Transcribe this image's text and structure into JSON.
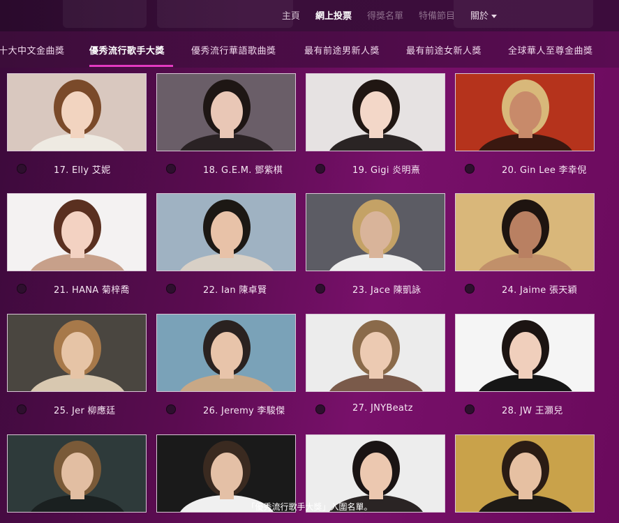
{
  "nav": {
    "home": "主頁",
    "vote": "網上投票",
    "winners": "得獎名單",
    "special": "特備節目",
    "about": "關於"
  },
  "tabs": [
    "十大中文金曲獎",
    "優秀流行歌手大獎",
    "優秀流行華語歌曲獎",
    "最有前途男新人獎",
    "最有前途女新人獎",
    "全球華人至尊金曲獎"
  ],
  "active_tab": "優秀流行歌手大獎",
  "candidates": [
    {
      "label": "17. Elly 艾妮",
      "bg": "#d9c8bf",
      "hair": "#7a4a2a",
      "skin": "#f2d4c0",
      "cloth": "#eeeae2"
    },
    {
      "label": "18. G.E.M. 鄧紫棋",
      "bg": "#6a5e68",
      "hair": "#1e1614",
      "skin": "#e9c7b6",
      "cloth": "#2a2224"
    },
    {
      "label": "19. Gigi 炎明熹",
      "bg": "#e6e2e2",
      "hair": "#201612",
      "skin": "#f3d7c8",
      "cloth": "#2a2424"
    },
    {
      "label": "20. Gin Lee 李幸倪",
      "bg": "#b5331c",
      "hair": "#d8b87a",
      "skin": "#c88a6a",
      "cloth": "#3a1810"
    },
    {
      "label": "21. HANA 菊梓喬",
      "bg": "#f4f2f2",
      "hair": "#5a3020",
      "skin": "#f3d2c2",
      "cloth": "#c7a08a"
    },
    {
      "label": "22. Ian 陳卓賢",
      "bg": "#9fb2c2",
      "hair": "#1c1814",
      "skin": "#e8c2a8",
      "cloth": "#d8d0c6"
    },
    {
      "label": "23. Jace 陳凱詠",
      "bg": "#5c5c64",
      "hair": "#c4a266",
      "skin": "#d9b49a",
      "cloth": "#ededed"
    },
    {
      "label": "24. Jaime 張天穎",
      "bg": "#d9b77a",
      "hair": "#1e1410",
      "skin": "#b98062",
      "cloth": "#c1906a"
    },
    {
      "label": "25. Jer 柳應廷",
      "bg": "#4a4640",
      "hair": "#a7794a",
      "skin": "#e6c4a6",
      "cloth": "#d8c8b0"
    },
    {
      "label": "26. Jeremy 李駿傑",
      "bg": "#7aa2b8",
      "hair": "#2a2220",
      "skin": "#e8c4aa",
      "cloth": "#c8a886"
    },
    {
      "label": "27. JNYBeatz",
      "bg": "#ececec",
      "hair": "#8a6a4a",
      "skin": "#eccab2",
      "cloth": "#7a5a4a"
    },
    {
      "label": "28. JW 王灝兒",
      "bg": "#f5f5f5",
      "hair": "#1c1412",
      "skin": "#f0cfbc",
      "cloth": "#161616"
    },
    {
      "label": "",
      "bg": "#2e3a3a",
      "hair": "#7a5a38",
      "skin": "#e2bea2",
      "cloth": "#1a2020"
    },
    {
      "label": "",
      "bg": "#1a1a1a",
      "hair": "#3a2a20",
      "skin": "#e4c0a6",
      "cloth": "#f0f0f0"
    },
    {
      "label": "",
      "bg": "#ededed",
      "hair": "#1a1414",
      "skin": "#ecc8b0",
      "cloth": "#2a2424"
    },
    {
      "label": "",
      "bg": "#c9a24a",
      "hair": "#2a1c14",
      "skin": "#e6c0a2",
      "cloth": "#1e1a16"
    }
  ],
  "caption": "「優秀流行歌手大獎」入圍名單。"
}
